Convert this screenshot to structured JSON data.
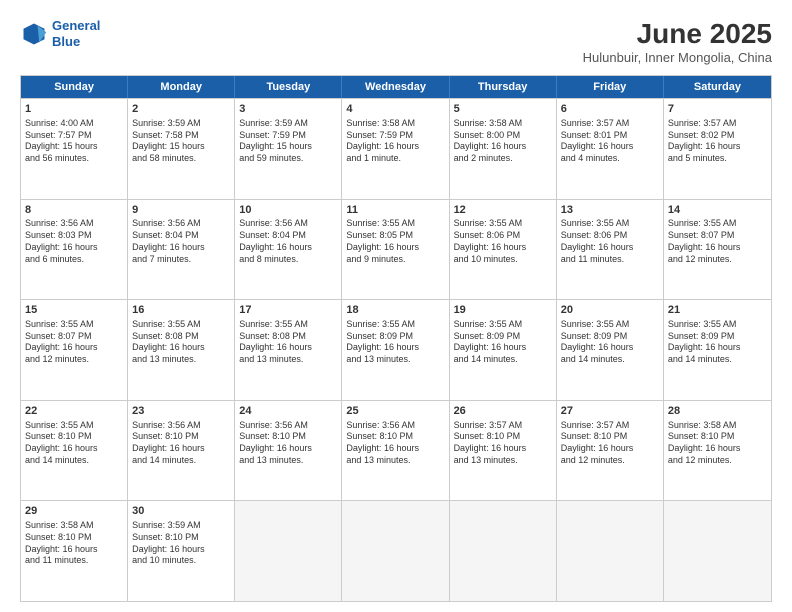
{
  "logo": {
    "line1": "General",
    "line2": "Blue"
  },
  "title": "June 2025",
  "subtitle": "Hulunbuir, Inner Mongolia, China",
  "header_days": [
    "Sunday",
    "Monday",
    "Tuesday",
    "Wednesday",
    "Thursday",
    "Friday",
    "Saturday"
  ],
  "weeks": [
    [
      {
        "day": "1",
        "text": "Sunrise: 4:00 AM\nSunset: 7:57 PM\nDaylight: 15 hours\nand 56 minutes."
      },
      {
        "day": "2",
        "text": "Sunrise: 3:59 AM\nSunset: 7:58 PM\nDaylight: 15 hours\nand 58 minutes."
      },
      {
        "day": "3",
        "text": "Sunrise: 3:59 AM\nSunset: 7:59 PM\nDaylight: 15 hours\nand 59 minutes."
      },
      {
        "day": "4",
        "text": "Sunrise: 3:58 AM\nSunset: 7:59 PM\nDaylight: 16 hours\nand 1 minute."
      },
      {
        "day": "5",
        "text": "Sunrise: 3:58 AM\nSunset: 8:00 PM\nDaylight: 16 hours\nand 2 minutes."
      },
      {
        "day": "6",
        "text": "Sunrise: 3:57 AM\nSunset: 8:01 PM\nDaylight: 16 hours\nand 4 minutes."
      },
      {
        "day": "7",
        "text": "Sunrise: 3:57 AM\nSunset: 8:02 PM\nDaylight: 16 hours\nand 5 minutes."
      }
    ],
    [
      {
        "day": "8",
        "text": "Sunrise: 3:56 AM\nSunset: 8:03 PM\nDaylight: 16 hours\nand 6 minutes."
      },
      {
        "day": "9",
        "text": "Sunrise: 3:56 AM\nSunset: 8:04 PM\nDaylight: 16 hours\nand 7 minutes."
      },
      {
        "day": "10",
        "text": "Sunrise: 3:56 AM\nSunset: 8:04 PM\nDaylight: 16 hours\nand 8 minutes."
      },
      {
        "day": "11",
        "text": "Sunrise: 3:55 AM\nSunset: 8:05 PM\nDaylight: 16 hours\nand 9 minutes."
      },
      {
        "day": "12",
        "text": "Sunrise: 3:55 AM\nSunset: 8:06 PM\nDaylight: 16 hours\nand 10 minutes."
      },
      {
        "day": "13",
        "text": "Sunrise: 3:55 AM\nSunset: 8:06 PM\nDaylight: 16 hours\nand 11 minutes."
      },
      {
        "day": "14",
        "text": "Sunrise: 3:55 AM\nSunset: 8:07 PM\nDaylight: 16 hours\nand 12 minutes."
      }
    ],
    [
      {
        "day": "15",
        "text": "Sunrise: 3:55 AM\nSunset: 8:07 PM\nDaylight: 16 hours\nand 12 minutes."
      },
      {
        "day": "16",
        "text": "Sunrise: 3:55 AM\nSunset: 8:08 PM\nDaylight: 16 hours\nand 13 minutes."
      },
      {
        "day": "17",
        "text": "Sunrise: 3:55 AM\nSunset: 8:08 PM\nDaylight: 16 hours\nand 13 minutes."
      },
      {
        "day": "18",
        "text": "Sunrise: 3:55 AM\nSunset: 8:09 PM\nDaylight: 16 hours\nand 13 minutes."
      },
      {
        "day": "19",
        "text": "Sunrise: 3:55 AM\nSunset: 8:09 PM\nDaylight: 16 hours\nand 14 minutes."
      },
      {
        "day": "20",
        "text": "Sunrise: 3:55 AM\nSunset: 8:09 PM\nDaylight: 16 hours\nand 14 minutes."
      },
      {
        "day": "21",
        "text": "Sunrise: 3:55 AM\nSunset: 8:09 PM\nDaylight: 16 hours\nand 14 minutes."
      }
    ],
    [
      {
        "day": "22",
        "text": "Sunrise: 3:55 AM\nSunset: 8:10 PM\nDaylight: 16 hours\nand 14 minutes."
      },
      {
        "day": "23",
        "text": "Sunrise: 3:56 AM\nSunset: 8:10 PM\nDaylight: 16 hours\nand 14 minutes."
      },
      {
        "day": "24",
        "text": "Sunrise: 3:56 AM\nSunset: 8:10 PM\nDaylight: 16 hours\nand 13 minutes."
      },
      {
        "day": "25",
        "text": "Sunrise: 3:56 AM\nSunset: 8:10 PM\nDaylight: 16 hours\nand 13 minutes."
      },
      {
        "day": "26",
        "text": "Sunrise: 3:57 AM\nSunset: 8:10 PM\nDaylight: 16 hours\nand 13 minutes."
      },
      {
        "day": "27",
        "text": "Sunrise: 3:57 AM\nSunset: 8:10 PM\nDaylight: 16 hours\nand 12 minutes."
      },
      {
        "day": "28",
        "text": "Sunrise: 3:58 AM\nSunset: 8:10 PM\nDaylight: 16 hours\nand 12 minutes."
      }
    ],
    [
      {
        "day": "29",
        "text": "Sunrise: 3:58 AM\nSunset: 8:10 PM\nDaylight: 16 hours\nand 11 minutes."
      },
      {
        "day": "30",
        "text": "Sunrise: 3:59 AM\nSunset: 8:10 PM\nDaylight: 16 hours\nand 10 minutes."
      },
      {
        "day": "",
        "text": ""
      },
      {
        "day": "",
        "text": ""
      },
      {
        "day": "",
        "text": ""
      },
      {
        "day": "",
        "text": ""
      },
      {
        "day": "",
        "text": ""
      }
    ]
  ]
}
